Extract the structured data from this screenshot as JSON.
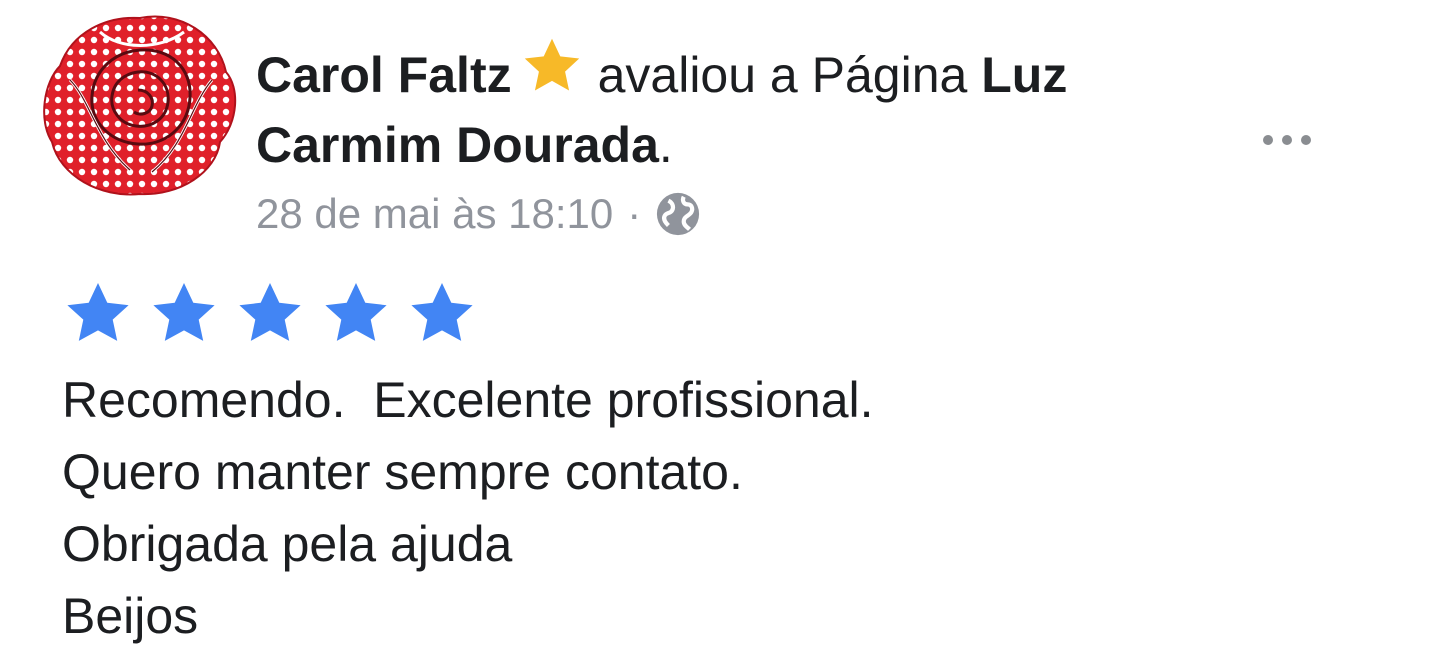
{
  "post": {
    "author": "Carol Faltz",
    "verb": "avaliou a Página",
    "page_name": "Luz Carmim Dourada",
    "period": ".",
    "timestamp": "28 de mai às 18:10",
    "separator": "·",
    "privacy_icon": "globe-icon",
    "author_badge_icon": "star-badge-icon",
    "badge_color": "#f7b928",
    "more_icon": "more-options-icon"
  },
  "rating": {
    "value": 5,
    "max": 5,
    "star_color": "#4285f4"
  },
  "review": {
    "lines": [
      "Recomendo.  Excelente profissional.",
      "Quero manter sempre contato.",
      "Obrigada pela ajuda",
      "Beijos"
    ]
  }
}
